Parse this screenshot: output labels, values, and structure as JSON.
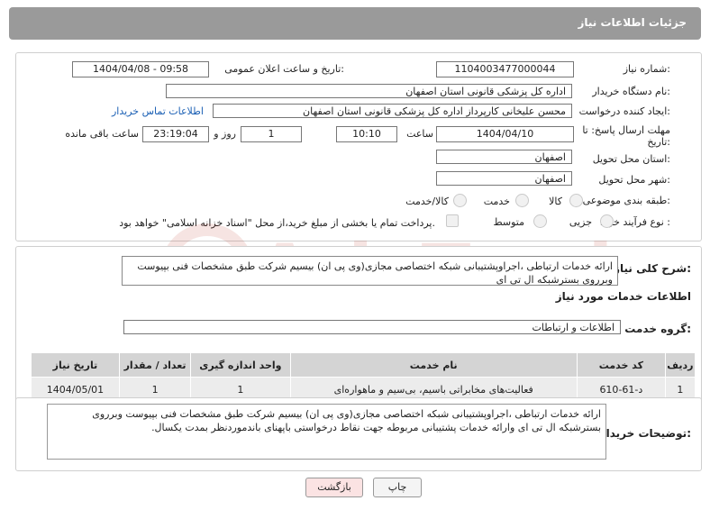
{
  "header": {
    "title": "جزئیات اطلاعات نیاز"
  },
  "fields": {
    "need_number_label": "شماره نیاز:",
    "need_number": "1104003477000044",
    "announce_label": "تاریخ و ساعت اعلان عمومی:",
    "announce_value": "1404/04/08 - 09:58",
    "buyer_label": "نام دستگاه خریدار:",
    "buyer_value": "اداره کل پزشکی قانونی استان اصفهان",
    "creator_label": "ایجاد کننده درخواست:",
    "creator_value": "محسن علیخانی کارپرداز اداره کل پزشکی قانونی استان اصفهان",
    "contact_link": "اطلاعات تماس خریدار",
    "deadline_label_1": "مهلت ارسال پاسخ: تا",
    "deadline_label_2": "تاریخ:",
    "deadline_date": "1404/04/10",
    "time_label": "ساعت",
    "deadline_time": "10:10",
    "days_value": "1",
    "days_label": "روز و",
    "remaining_value": "23:19:04",
    "remaining_label": "ساعت باقی مانده",
    "province_label": "استان محل تحویل:",
    "province_value": "اصفهان",
    "city_label": "شهر محل تحویل:",
    "city_value": "اصفهان",
    "category_label": "طبقه بندی موضوعی:",
    "category_options": [
      "کالا",
      "خدمت",
      "کالا/خدمت"
    ],
    "process_label": "نوع فرآیند خرید :",
    "process_options": [
      "جزیی",
      "متوسط"
    ],
    "payment_note": "پرداخت تمام یا بخشی از مبلغ خرید،از محل \"اسناد خزانه اسلامی\" خواهد بود."
  },
  "summary": {
    "label": "شرح کلی نیاز:",
    "text": "ارائه خدمات ارتباطی ،اجراوپشتیبانی شبکه اختصاصی مجازی(وی پی ان) بیسیم شرکت طبق مشخصات فنی بپیوست وبرروی بسترشبکه ال تی ای"
  },
  "services": {
    "section_title": "اطلاعات خدمات مورد نیاز",
    "group_label": "گروه خدمت:",
    "group_value": "اطلاعات و ارتباطات",
    "columns": [
      "ردیف",
      "کد خدمت",
      "نام خدمت",
      "واحد اندازه گیری",
      "تعداد / مقدار",
      "تاریخ نیاز"
    ],
    "rows": [
      [
        "1",
        "د-61-610",
        "فعالیت‌های مخابراتی باسیم، بی‌سیم و ماهواره‌ای",
        "1",
        "1",
        "1404/05/01"
      ]
    ]
  },
  "buyer_notes": {
    "label": "توضیحات خریدار:",
    "text": "ارائه خدمات ارتباطی ،اجراوپشتیبانی شبکه اختصاصی مجازی(وی پی ان) بیسیم شرکت طبق مشخصات فنی بپیوست وبرروی بسترشبکه ال تی ای وارائه خدمات پشتیبانی مربوطه جهت نقاط درخواستی باپهنای باندموردنظر بمدت یکسال."
  },
  "buttons": {
    "print": "چاپ",
    "back": "بازگشت"
  },
  "watermark_text": "AriaTender.neT",
  "colors": {
    "title_bg": "#9a9a9a",
    "link": "#1a5fb4",
    "back_bg": "#fbe3e3"
  }
}
